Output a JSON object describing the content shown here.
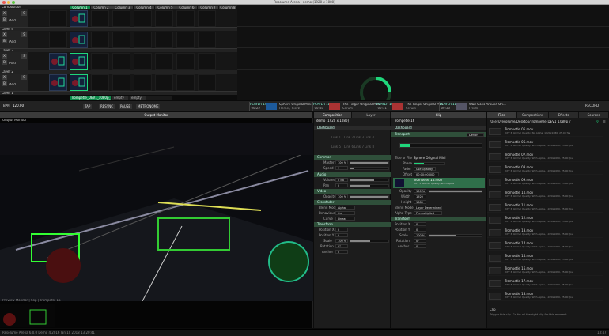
{
  "window": {
    "title": "Resolume Arena - demo (1920 x 1080)"
  },
  "composition": {
    "label": "Composition",
    "columns": [
      "Column 1",
      "Column 2",
      "Column 3",
      "Column 4",
      "Column 5",
      "Column 6",
      "Column 7",
      "Column 8"
    ],
    "active_column": 0
  },
  "layers": [
    {
      "name": "Layer 4",
      "add": "Add",
      "clips": [
        {
          "col": 1,
          "label": "Trompetle 19",
          "active": false
        }
      ],
      "btn_x": "X",
      "btn_b": "B",
      "btn_s": "S"
    },
    {
      "name": "Layer 3",
      "add": "Add",
      "clips": [
        {
          "col": 1,
          "label": "Trompetle 18",
          "active": false
        }
      ],
      "btn_x": "X",
      "btn_b": "B",
      "btn_s": "S"
    },
    {
      "name": "Layer 2",
      "add": "Add",
      "clips": [
        {
          "col": 0,
          "label": "Trompetle 17",
          "active": false
        },
        {
          "col": 1,
          "label": "Trompetle 18",
          "active": true
        }
      ],
      "btn_x": "X",
      "btn_b": "B",
      "btn_s": "S"
    },
    {
      "name": "Layer 1",
      "add": "Add",
      "clips": [
        {
          "col": 0,
          "label": "Trompetle 16",
          "active": false
        },
        {
          "col": 1,
          "label": "Trompetle 17",
          "active": true
        }
      ],
      "btn_x": "X",
      "btn_b": "B",
      "btn_s": "S"
    }
  ],
  "deck_tabs": [
    "Trompetle_DEV1_1080p_",
    "empty",
    "empty"
  ],
  "transport": {
    "bpm_label": "BPM",
    "bpm": "120.00",
    "buttons": [
      "TAP",
      "RESYNC",
      "PAUSE",
      "METRONOME"
    ],
    "decks": [
      {
        "player": "PLAYER 1A",
        "time": "-00:22",
        "title": "Sphere Original Mini",
        "artist": "Hernel, Cierz"
      },
      {
        "player": "PLAYER 1B",
        "time": "-00:38",
        "title": "The Finger Original Mini",
        "artist": "Serum"
      },
      {
        "player": "PLAYER 1A",
        "time": "-00:11",
        "title": "The Finger Original Mini",
        "artist": "Serum"
      },
      {
        "player": "PLAYER 1B",
        "time": "-00:38",
        "title": "Wait Goes Around Ori...",
        "artist": "Freide"
      }
    ],
    "record": "RECORD"
  },
  "output": {
    "title": "Output Monitor",
    "bottom_label": "Preview Monitor | Clip | Trompetle 16"
  },
  "composition_panel": {
    "tabs": [
      "Composition",
      "Layer"
    ],
    "device": "demo (1920 x 1080)",
    "sections": {
      "dashboard": "Dashboard",
      "common": "Common",
      "audio": "Audio",
      "video": "Video",
      "crossfader": "Crossfader",
      "transform": "Transform"
    },
    "links": [
      "Link 1",
      "Link 2",
      "Link 3",
      "Link 4",
      "Link 5",
      "Link 6",
      "Link 7",
      "Link 8"
    ],
    "master_label": "Master",
    "master_val": "100 %",
    "speed_label": "Speed",
    "speed_val": "1",
    "volume_label": "Volume",
    "volume_val": "0 dB",
    "pan_label": "Pan",
    "pan_val": "0",
    "opacity_label": "Opacity",
    "opacity_val": "100 %",
    "blend_label": "Blend Mode",
    "blend_val": "Alpha",
    "behaviour_label": "Behaviour",
    "behaviour_val": "Cut",
    "curve_label": "Curve",
    "curve_val": "Linear",
    "posx_label": "Position X",
    "posx_val": "0",
    "posy_label": "Position Y",
    "posy_val": "0",
    "scale_label": "Scale",
    "scale_val": "100 %",
    "rotation_label": "Rotation",
    "rotation_val": "0°",
    "anchor_label": "Anchor",
    "anchor_val": "0"
  },
  "clip_panel": {
    "tab": "Clip",
    "clip_name": "Trompetle 16",
    "sections": {
      "dashboard": "Dashboard",
      "transport": "Transport",
      "transform": "Transform"
    },
    "transport_mode": "Denon",
    "title_label": "Title or File",
    "title_val": "Sphere Original Mini",
    "phase_label": "Phase",
    "fader_label": "Fader",
    "fader_val": "Use Opacity",
    "offset_label": "Offset",
    "offset_val": "00:00:00.000",
    "file_info": "Trompetle 16.mov",
    "file_meta": "DXV 3 Normal Quality, With Alpha",
    "opacity_label": "Opacity",
    "opacity_val": "100 %",
    "width_label": "Width",
    "width_val": "1920",
    "height_label": "Height",
    "height_val": "1080",
    "blend_label": "Blend Mode",
    "blend_val": "Layer Determined",
    "alpha_label": "Alpha Type",
    "alpha_val": "Premultiplied",
    "posx_label": "Position X",
    "posx_val": "0",
    "posy_label": "Position Y",
    "posy_val": "0",
    "scale_label": "Scale",
    "scale_val": "100 %",
    "rotation_label": "Rotation",
    "rotation_val": "0°",
    "anchor_label": "Anchor",
    "anchor_val": "0"
  },
  "files_panel": {
    "tabs": [
      "Files",
      "Compositions",
      "Effects",
      "Sources"
    ],
    "path": "/Users/resolume/Desktop/Trompetle_DEV1_1080p_/",
    "items": [
      {
        "name": "Trompetle 05.mov",
        "meta": "DXV 3 Normal Quality, No Alpha, 1920x1080, 25.00 fps"
      },
      {
        "name": "Trompetle 06.mov",
        "meta": "DXV 3 Normal Quality, With Alpha, 1920x1080, 25.00 fps"
      },
      {
        "name": "Trompetle 07.mov",
        "meta": "DXV 3 Normal Quality, With Alpha, 1920x1080, 25.00 fps"
      },
      {
        "name": "Trompetle 08.mov",
        "meta": "DXV 3 Normal Quality, With Alpha, 1920x1080, 25.00 fps"
      },
      {
        "name": "Trompetle 09.mov",
        "meta": "DXV 3 Normal Quality, With Alpha, 1920x1080, 25.00 fps"
      },
      {
        "name": "Trompetle 10.mov",
        "meta": "DXV 3 Normal Quality, With Alpha, 1920x1080, 25.00 fps"
      },
      {
        "name": "Trompetle 11.mov",
        "meta": "DXV 3 Normal Quality, With Alpha, 1920x1080, 25.00 fps"
      },
      {
        "name": "Trompetle 12.mov",
        "meta": "DXV 3 Normal Quality, With Alpha, 1920x1080, 25.00 fps"
      },
      {
        "name": "Trompetle 13.mov",
        "meta": "DXV 3 Normal Quality, With Alpha, 1920x1080, 25.00 fps"
      },
      {
        "name": "Trompetle 14.mov",
        "meta": "DXV 3 Normal Quality, With Alpha, 1920x1080, 25.00 fps"
      },
      {
        "name": "Trompetle 15.mov",
        "meta": "DXV 3 Normal Quality, With Alpha, 1920x1080, 25.00 fps"
      },
      {
        "name": "Trompetle 16.mov",
        "meta": "DXV 3 Normal Quality, With Alpha, 1920x1080, 25.00 fps"
      },
      {
        "name": "Trompetle 17.mov",
        "meta": "DXV 3 Normal Quality, With Alpha, 1920x1080, 25.00 fps"
      },
      {
        "name": "Trompetle 18.mov",
        "meta": "DXV 3 Normal Quality, With Alpha, 1920x1080, 25.00 fps"
      }
    ],
    "footer_title": "Clip",
    "footer_text": "Trigger this clip. Go for all the right clip for this moment."
  },
  "statusbar": {
    "left": "Resolume Arena 6.0.0 Demo 4 2016 Jan 10 2018 13:20:41",
    "right": "13:47"
  },
  "colors": {
    "accent": "#1fd67b",
    "panel": "#1e1e1e",
    "section": "#2f4f3a"
  }
}
